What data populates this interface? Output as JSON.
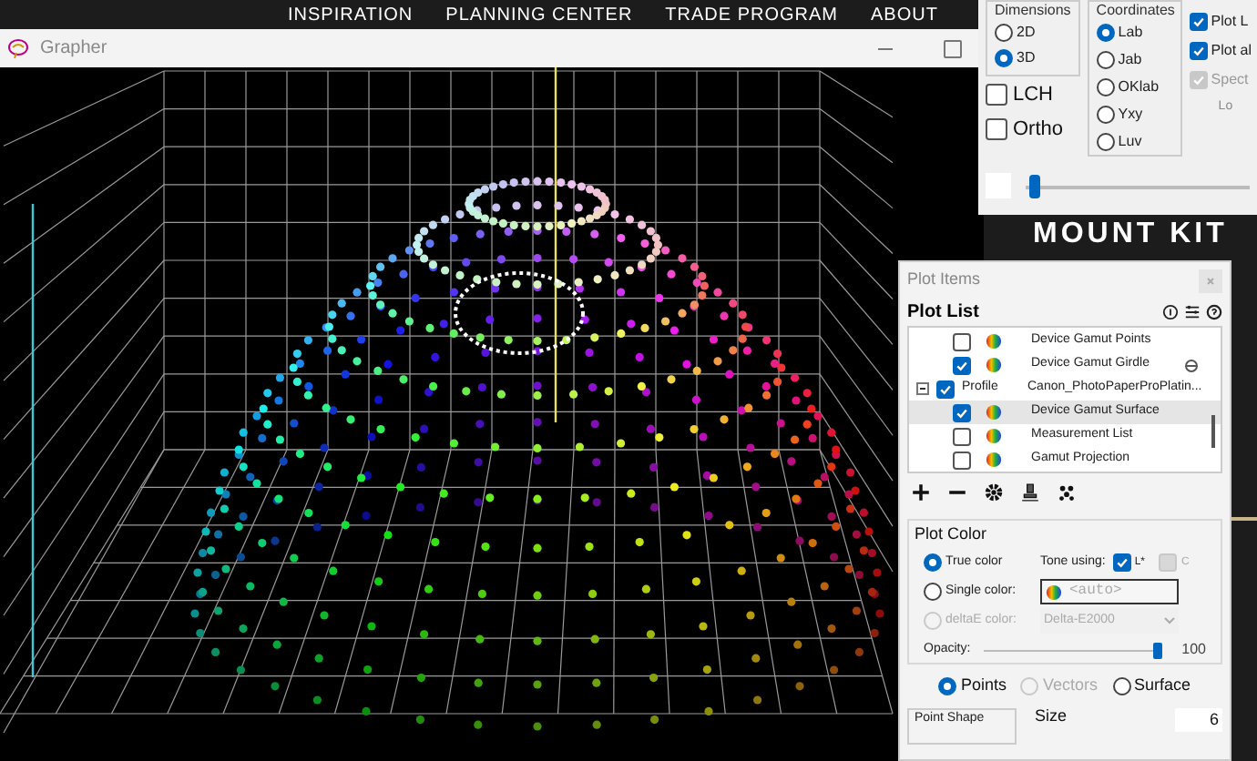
{
  "website": {
    "nav": [
      "INSPIRATION",
      "PLANNING CENTER",
      "TRADE PROGRAM",
      "ABOUT"
    ],
    "brand": "MOUNT KIT"
  },
  "grapher": {
    "title": "Grapher"
  },
  "settings": {
    "dimensions": {
      "title": "Dimensions",
      "options": [
        {
          "label": "2D",
          "selected": false
        },
        {
          "label": "3D",
          "selected": true
        }
      ]
    },
    "coordinates": {
      "title": "Coordinates",
      "options": [
        {
          "label": "Lab",
          "selected": true
        },
        {
          "label": "Jab",
          "selected": false
        },
        {
          "label": "OKlab",
          "selected": false
        },
        {
          "label": "Yxy",
          "selected": false
        },
        {
          "label": "Luv",
          "selected": false
        }
      ]
    },
    "toggles": [
      {
        "label": "LCH",
        "checked": false
      },
      {
        "label": "Ortho",
        "checked": false
      }
    ],
    "plot_checks": [
      {
        "label": "Plot L",
        "checked": true,
        "disabled": false
      },
      {
        "label": "Plot al",
        "checked": true,
        "disabled": false
      },
      {
        "label": "Spect",
        "checked": true,
        "disabled": true
      }
    ],
    "note": "Lo",
    "slider": {
      "level": 0.02
    }
  },
  "plot_items": {
    "title": "Plot Items",
    "list_title": "Plot List",
    "rows": [
      {
        "label": "Device Gamut Points",
        "checked": false,
        "selected": false,
        "marker": false
      },
      {
        "label": "Device Gamut Girdle",
        "checked": true,
        "selected": false,
        "marker": true
      },
      {
        "type_label": "Profile",
        "label": "Canon_PhotoPaperProPlatin...",
        "checked": true,
        "selected": false,
        "expanded": true,
        "children": [
          {
            "label": "Device Gamut Surface",
            "checked": true,
            "selected": true,
            "marker": false
          },
          {
            "label": "Measurement List",
            "checked": false,
            "selected": false,
            "marker": false
          },
          {
            "label": "Gamut Projection",
            "checked": false,
            "selected": false,
            "marker": false
          }
        ]
      }
    ],
    "plot_color": {
      "title": "Plot Color",
      "modes": [
        {
          "label": "True color",
          "selected": true,
          "disabled": false
        },
        {
          "label": "Single color:",
          "selected": false,
          "disabled": false
        },
        {
          "label": "deltaE color:",
          "selected": false,
          "disabled": true
        }
      ],
      "tone": {
        "label": "Tone using:",
        "options": [
          {
            "label": "L*",
            "checked": true,
            "disabled": false
          },
          {
            "label": "C",
            "checked": false,
            "disabled": true
          }
        ]
      },
      "color_field": {
        "placeholder": "<auto>"
      },
      "metric": {
        "value": "Delta-E2000",
        "disabled": true
      },
      "opacity": {
        "label": "Opacity:",
        "level": 0.97,
        "reading": "100"
      }
    },
    "display": [
      {
        "label": "Points",
        "selected": true,
        "disabled": false
      },
      {
        "label": "Vectors",
        "selected": false,
        "disabled": true
      },
      {
        "label": "Surface",
        "selected": false,
        "disabled": false
      }
    ],
    "point_shape": {
      "title": "Point Shape"
    },
    "size": {
      "label": "Size",
      "value": "6"
    }
  }
}
